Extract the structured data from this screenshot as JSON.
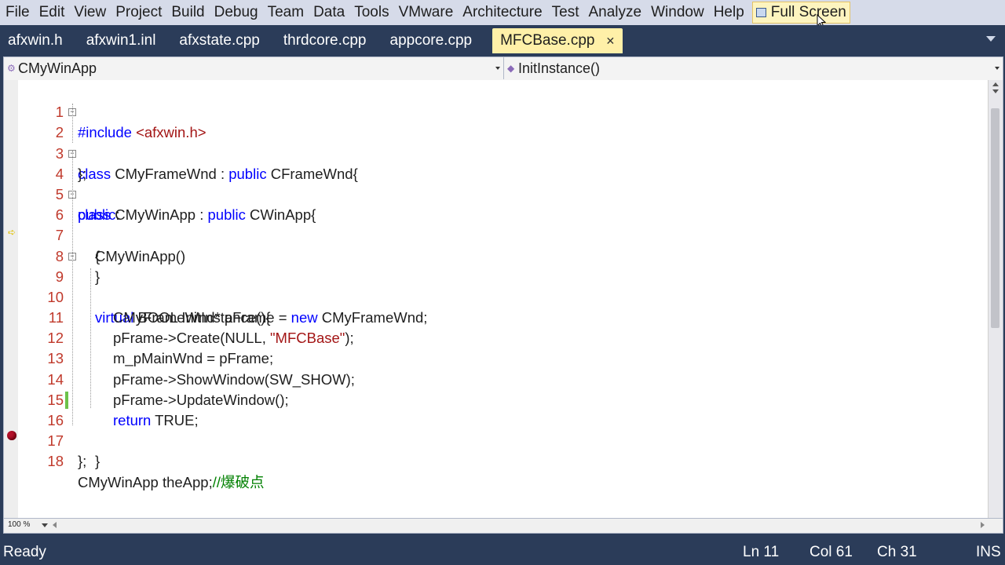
{
  "menu": [
    "File",
    "Edit",
    "View",
    "Project",
    "Build",
    "Debug",
    "Team",
    "Data",
    "Tools",
    "VMware",
    "Architecture",
    "Test",
    "Analyze",
    "Window",
    "Help"
  ],
  "fullscreen_label": "Full Screen",
  "tabs": [
    "afxwin.h",
    "afxwin1.inl",
    "afxstate.cpp",
    "thrdcore.cpp",
    "appcore.cpp"
  ],
  "active_tab": "MFCBase.cpp",
  "nav": {
    "class_combo": "CMyWinApp",
    "member_combo": "InitInstance()"
  },
  "code_lines": [
    {
      "n": "1"
    },
    {
      "n": "2"
    },
    {
      "n": "3"
    },
    {
      "n": "4"
    },
    {
      "n": "5"
    },
    {
      "n": "6"
    },
    {
      "n": "7"
    },
    {
      "n": "8"
    },
    {
      "n": "9"
    },
    {
      "n": "10"
    },
    {
      "n": "11"
    },
    {
      "n": "12"
    },
    {
      "n": "13"
    },
    {
      "n": "14"
    },
    {
      "n": "15"
    },
    {
      "n": "16"
    },
    {
      "n": "17"
    },
    {
      "n": "18"
    }
  ],
  "code": {
    "l1": [
      "#include ",
      "<afxwin.h>"
    ],
    "l2": [
      "class",
      " CMyFrameWnd : ",
      "public",
      " CFrameWnd{"
    ],
    "l3": "};",
    "l4": [
      "class",
      " CMyWinApp : ",
      "public",
      " CWinApp{"
    ],
    "l5": [
      "public",
      ":"
    ],
    "l6": "CMyWinApp()",
    "l7": "{",
    "l8": "}",
    "l9": [
      "virtual",
      " BOOL InitInstance(){"
    ],
    "l10": [
      "CMyFrameWnd* pFrame = ",
      "new",
      " CMyFrameWnd;"
    ],
    "l11": [
      "pFrame->Create(NULL, ",
      "\"MFCBase\"",
      ");"
    ],
    "l12": "m_pMainWnd = pFrame;",
    "l13": "pFrame->ShowWindow(SW_SHOW);",
    "l14": "pFrame->UpdateWindow();",
    "l15": [
      "return",
      " TRUE;"
    ],
    "l16": "}",
    "l17": "};",
    "l18": [
      "CMyWinApp theApp;",
      "//爆破点"
    ]
  },
  "zoom": "100 %",
  "status": {
    "ready": "Ready",
    "ln": "Ln 11",
    "col": "Col 61",
    "ch": "Ch 31",
    "ins": "INS"
  },
  "colors": {
    "chrome": "#2b3c59",
    "keyword": "#0000ff",
    "string": "#a31515",
    "comment": "#008000",
    "line_number": "#c0392b"
  }
}
